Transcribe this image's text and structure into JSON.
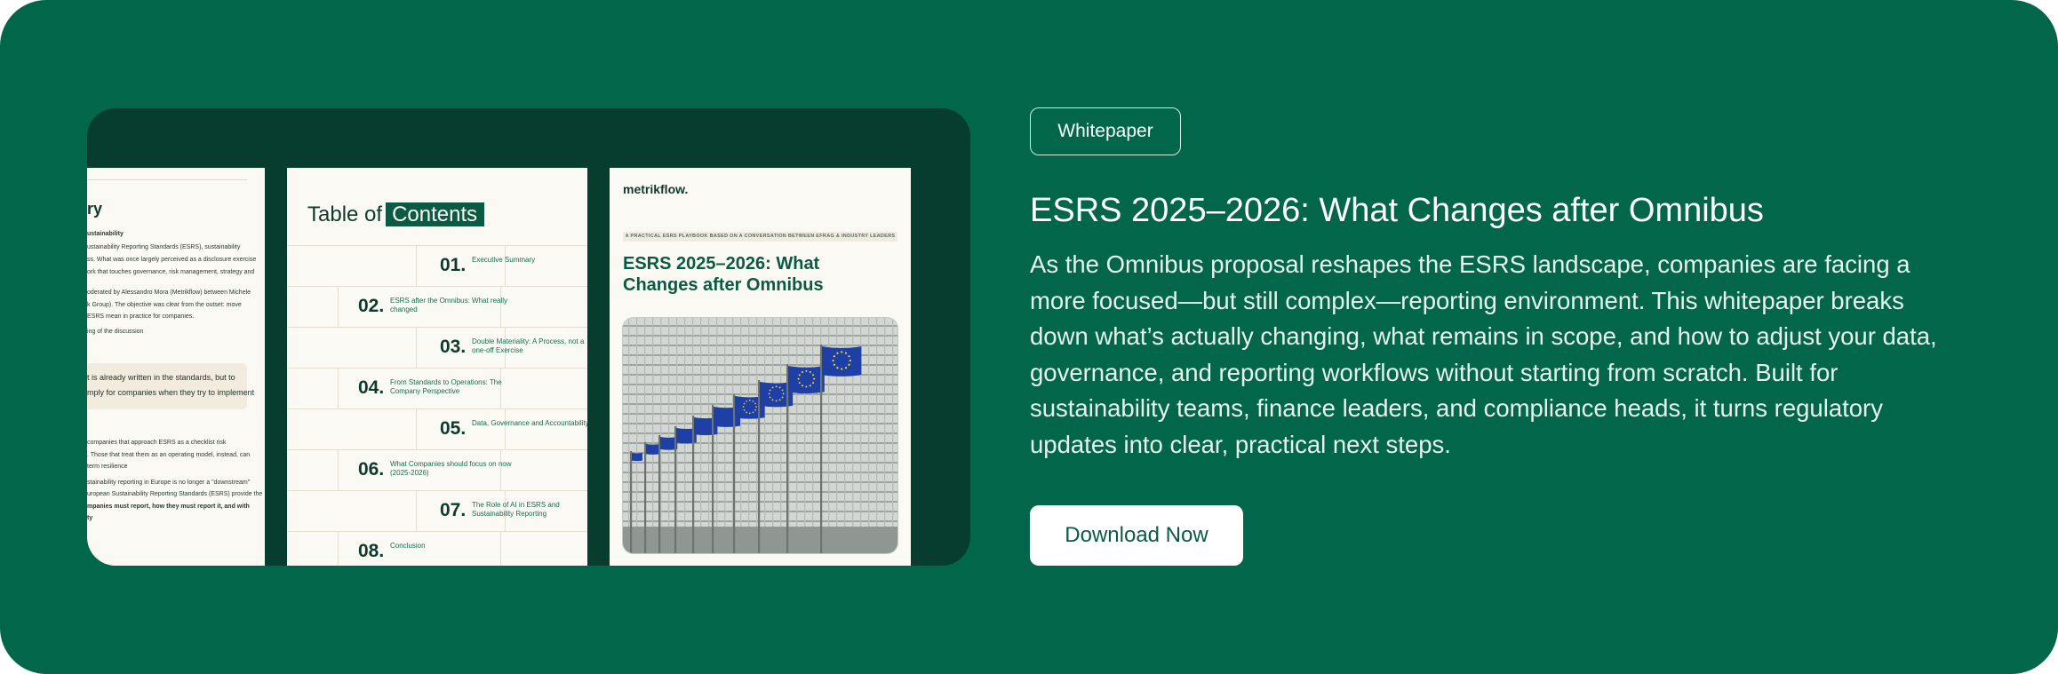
{
  "badge": "Whitepaper",
  "title": "ESRS 2025–2026: What Changes after Omnibus",
  "description": "As the Omnibus proposal reshapes the ESRS landscape, companies are facing a more focused—but still complex—reporting environment. This whitepaper breaks down what’s actually changing, what remains in scope, and how to adjust your data, governance, and reporting workflows without starting from scratch. Built for sustainability teams, finance leaders, and compliance heads, it turns regulatory updates into clear, practical next steps.",
  "cta": "Download Now",
  "preview": {
    "summary_page": {
      "heading": "ry",
      "lines": [
        {
          "text": "ustainability",
          "bold": true
        },
        {
          "text": "ustainability Reporting Standards (ESRS), sustainability",
          "bold": false
        },
        {
          "text": "ss. What was once largely perceived as a disclosure exercise",
          "bold": false
        },
        {
          "text": "ork that touches governance, risk management, strategy and",
          "bold": false
        },
        {
          "text": "oderated by Alessandro Mora (Metrikflow) between Michele",
          "bold": false
        },
        {
          "text": "k Group). The objective was clear from the outset: move",
          "bold": false
        },
        {
          "text": "ESRS mean in practice for companies.",
          "bold": false
        },
        {
          "text": "ing of the discussion",
          "bold": false
        }
      ],
      "quote": [
        "t is already written in the standards, but to",
        "mply for companies when they try to implement"
      ],
      "lines2": [
        {
          "text": "companies that approach ESRS as a checklist risk",
          "bold": false
        },
        {
          "text": ". Those that treat them as an operating model, instead, can",
          "bold": false
        },
        {
          "text": "term resilience",
          "bold": false
        },
        {
          "text": "stainability reporting in Europe is no longer a \"downstream\"",
          "bold": false
        },
        {
          "text": "uropean Sustainability Reporting Standards (ESRS) provide the",
          "bold": false
        },
        {
          "text": "mpanies must report, how they must report it, and with",
          "bold": true
        },
        {
          "text": "ty",
          "bold": true
        }
      ]
    },
    "toc_page": {
      "title_prefix": "Table of",
      "title_highlight": "Contents",
      "items": [
        {
          "num": "01.",
          "text": "Executive Summary"
        },
        {
          "num": "02.",
          "text": "ESRS after the Omnibus: What really changed"
        },
        {
          "num": "03.",
          "text": "Double Materiality: A Process, not a one-off Exercise"
        },
        {
          "num": "04.",
          "text": "From Standards to Operations: The Company Perspective"
        },
        {
          "num": "05.",
          "text": "Data, Governance and Accountability"
        },
        {
          "num": "06.",
          "text": "What Companies should focus on now (2025-2026)"
        },
        {
          "num": "07.",
          "text": "The Role of AI in ESRS and Sustainability Reporting"
        },
        {
          "num": "08.",
          "text": "Conclusion"
        }
      ]
    },
    "cover_page": {
      "logo": "metrikflow.",
      "tagline": "A PRACTICAL ESRS PLAYBOOK BASED ON A CONVERSATION BETWEEN EFRAG & INDUSTRY LEADERS",
      "title": "ESRS 2025–2026: What Changes after Omnibus"
    }
  },
  "colors": {
    "background": "#02664b",
    "panel": "#063d2e",
    "paper": "#fbf9f3",
    "accent": "#0b5a43",
    "eu_flag": "#1d3fa6",
    "eu_star": "#f7d51d"
  }
}
